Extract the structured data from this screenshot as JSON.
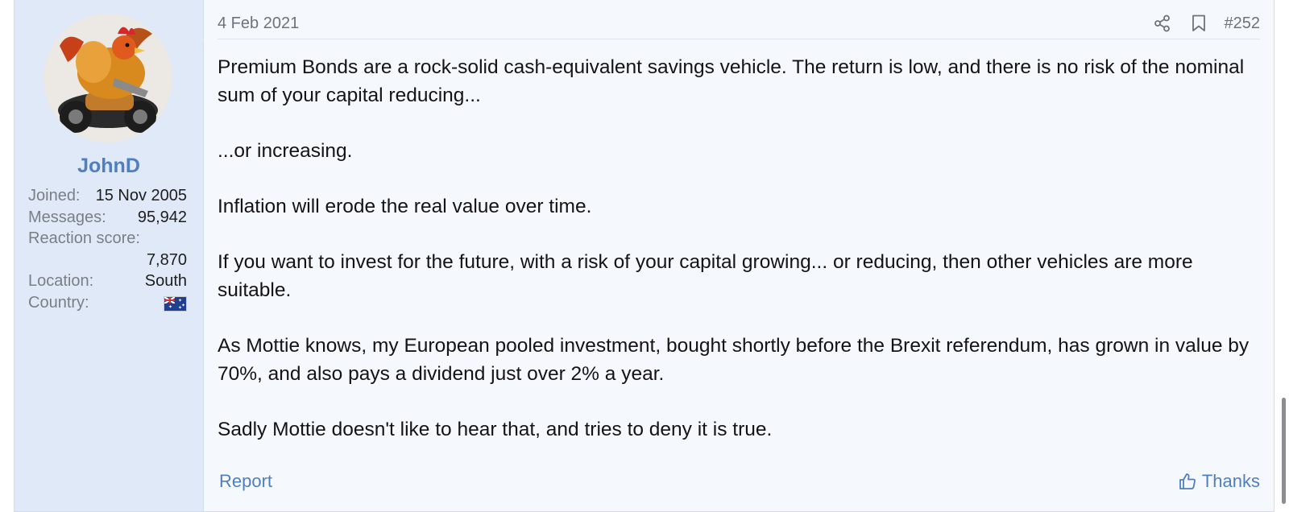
{
  "post": {
    "date": "4 Feb 2021",
    "number": "#252",
    "share_icon": "share-icon",
    "bookmark_icon": "bookmark-icon",
    "paragraphs": [
      "Premium Bonds are a rock-solid cash-equivalent savings vehicle. The return is low, and there is no risk of the nominal sum of your capital reducing...",
      "...or increasing.",
      "Inflation will erode the real value over time.",
      "If you want to invest for the future, with a risk of your capital growing... or reducing, then other vehicles are more suitable.",
      "As Mottie knows, my European pooled investment, bought shortly before the Brexit referendum, has grown in value by 70%, and also pays a dividend just over 2% a year.",
      "Sadly Mottie doesn't like to hear that, and tries to deny it is true."
    ],
    "report_label": "Report",
    "thanks_label": "Thanks",
    "thanks_icon": "thumbs-up-icon"
  },
  "user": {
    "name": "JohnD",
    "avatar_icon": "rooster-on-motorbike-avatar",
    "stats": {
      "joined_label": "Joined:",
      "joined_value": "15 Nov 2005",
      "messages_label": "Messages:",
      "messages_value": "95,942",
      "reaction_label": "Reaction score:",
      "reaction_value": "7,870",
      "location_label": "Location:",
      "location_value": "South",
      "country_label": "Country:",
      "country_flag": "australia-flag-icon"
    }
  },
  "colors": {
    "accent": "#4f7fc0",
    "user_panel": "#dfe9f8",
    "post_bg": "#f5f8fd"
  }
}
